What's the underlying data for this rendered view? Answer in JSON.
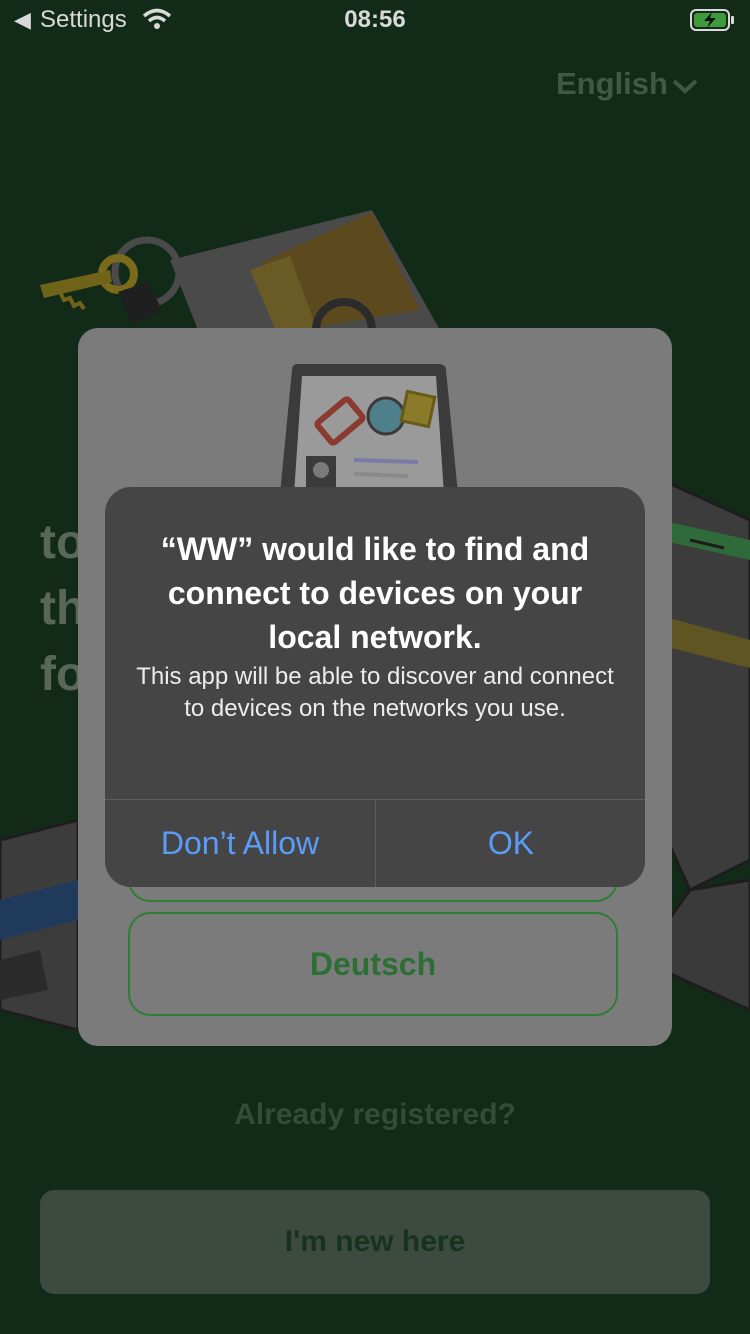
{
  "status_bar": {
    "back_arrow": "◀",
    "back_label": "Settings",
    "time": "08:56",
    "wifi_icon": "wifi-icon",
    "battery_icon": "battery-charging-icon"
  },
  "app": {
    "language_select": "English",
    "heading_lines": [
      "to",
      "th",
      "fo"
    ],
    "language_options": [
      "",
      "Deutsch"
    ],
    "already_registered": "Already registered?",
    "new_here_button": "I'm new here"
  },
  "alert": {
    "title": "“WW” would like to find and connect to devices on your local network.",
    "message": "This app will be able to discover and connect to devices on the networks you use.",
    "deny_button": "Don’t Allow",
    "ok_button": "OK"
  },
  "colors": {
    "background": "#122a18",
    "alert_background": "#454545",
    "alert_button": "#5a9cf8",
    "brand_green": "#2e7d36"
  }
}
